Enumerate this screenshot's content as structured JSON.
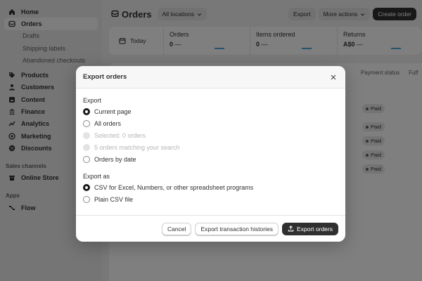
{
  "sidebar": {
    "items": [
      {
        "label": "Home",
        "icon": "home-icon"
      },
      {
        "label": "Orders",
        "icon": "orders-icon",
        "active": true
      },
      {
        "label": "Drafts",
        "sub": true
      },
      {
        "label": "Shipping labels",
        "sub": true
      },
      {
        "label": "Abandoned checkouts",
        "sub": true
      },
      {
        "label": "Products",
        "icon": "tag-icon"
      },
      {
        "label": "Customers",
        "icon": "person-icon"
      },
      {
        "label": "Content",
        "icon": "content-icon"
      },
      {
        "label": "Finance",
        "icon": "bank-icon"
      },
      {
        "label": "Analytics",
        "icon": "analytics-icon"
      },
      {
        "label": "Marketing",
        "icon": "target-icon"
      },
      {
        "label": "Discounts",
        "icon": "discount-icon"
      }
    ],
    "sales_channels_title": "Sales channels",
    "online_store": "Online Store",
    "apps_title": "Apps",
    "flow": "Flow"
  },
  "header": {
    "title": "Orders",
    "location": "All locations",
    "export": "Export",
    "more_actions": "More actions",
    "create_order": "Create order"
  },
  "stats": {
    "today": "Today",
    "orders_label": "Orders",
    "orders_value": "0",
    "items_label": "Items ordered",
    "items_value": "0",
    "returns_label": "Returns",
    "returns_value": "A$0",
    "dash": "—"
  },
  "table": {
    "payment_status": "Payment status",
    "fulfillment": "Fulf",
    "paid": "Paid"
  },
  "modal": {
    "title": "Export orders",
    "export_label": "Export",
    "export_options": {
      "current_page": "Current page",
      "all_orders": "All orders",
      "selected": "Selected: 0 orders",
      "matching": "5 orders matching your search",
      "by_date": "Orders by date"
    },
    "export_as_label": "Export as",
    "format_options": {
      "csv_excel": "CSV for Excel, Numbers, or other spreadsheet programs",
      "plain_csv": "Plain CSV file"
    },
    "cancel": "Cancel",
    "export_transactions": "Export transaction histories",
    "export_orders": "Export orders"
  },
  "colors": {
    "primary": "#303030",
    "overlay": "rgba(0,0,0,0.5)",
    "spark": "#4aa9d8"
  }
}
